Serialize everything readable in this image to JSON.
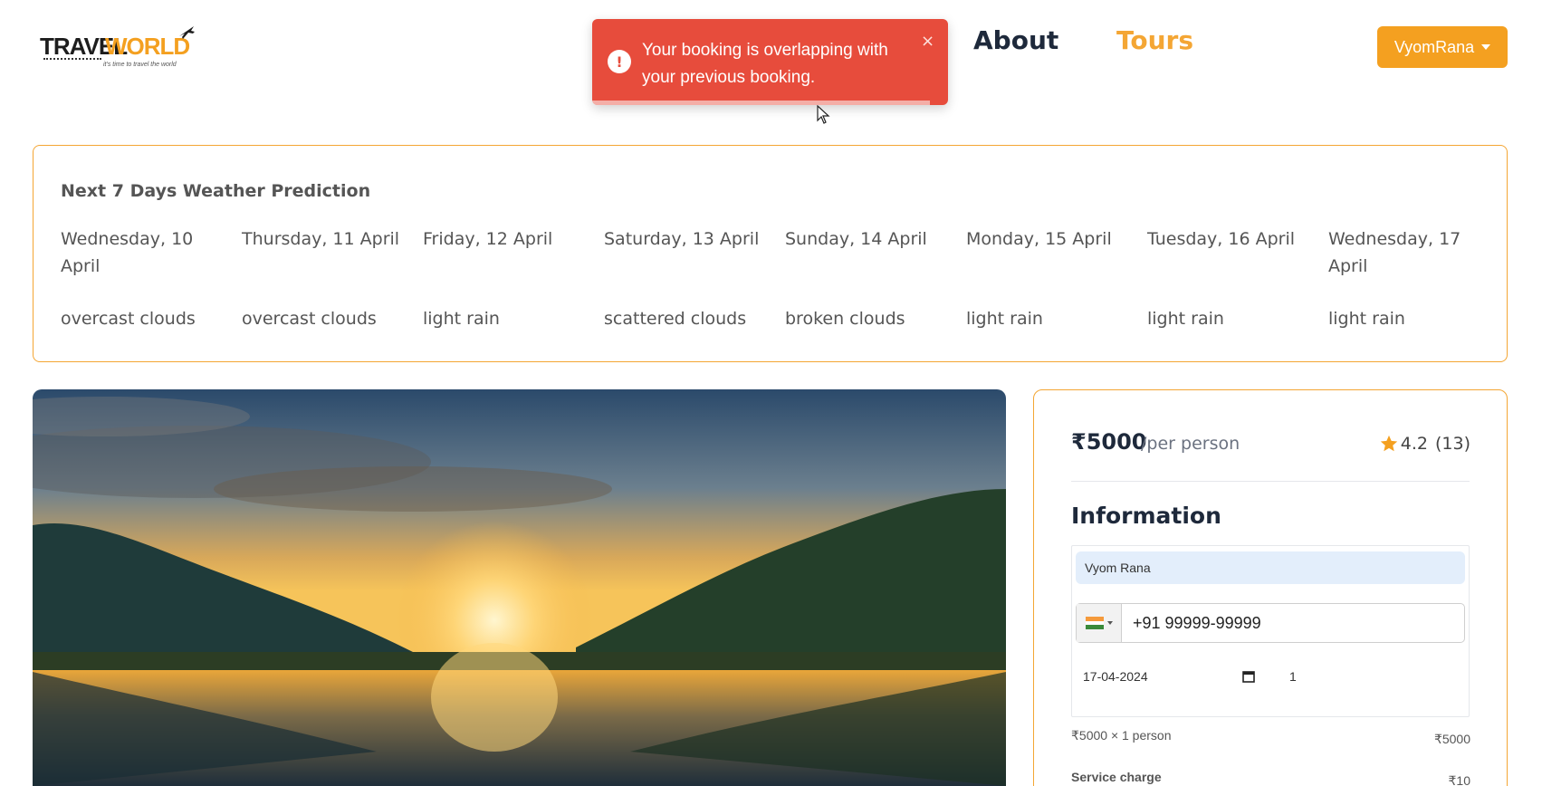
{
  "logo": {
    "word1": "TRAVEL",
    "word2": "WORLD",
    "tagline": "it's time to travel the world"
  },
  "nav": {
    "about": "About",
    "tours": "Tours"
  },
  "user": {
    "name": "VyomRana"
  },
  "toast": {
    "icon": "!",
    "message": "Your booking is overlapping with your previous booking.",
    "close": "×"
  },
  "weather": {
    "title": "Next 7 Days Weather Prediction",
    "days": [
      {
        "date": "Wednesday, 10 April",
        "condition": "overcast clouds"
      },
      {
        "date": "Thursday, 11 April",
        "condition": "overcast clouds"
      },
      {
        "date": "Friday, 12 April",
        "condition": "light rain"
      },
      {
        "date": "Saturday, 13 April",
        "condition": "scattered clouds"
      },
      {
        "date": "Sunday, 14 April",
        "condition": "broken clouds"
      },
      {
        "date": "Monday, 15 April",
        "condition": "light rain"
      },
      {
        "date": "Tuesday, 16 April",
        "condition": "light rain"
      },
      {
        "date": "Wednesday, 17 April",
        "condition": "light rain"
      }
    ]
  },
  "booking": {
    "price": "₹5000",
    "per": "/per person",
    "rating": "4.2",
    "reviews": "(13)",
    "info_title": "Information",
    "full_name": "Vyom Rana",
    "phone": "+91 99999-99999",
    "date": "17-04-2024",
    "guests": "1",
    "line_label": "₹5000  ×  1 person",
    "line_value": "₹5000",
    "service_label": "Service charge",
    "service_value": "₹10"
  },
  "colors": {
    "accent": "#f4a020",
    "toast": "#e74c3c",
    "border": "#f4a634"
  }
}
